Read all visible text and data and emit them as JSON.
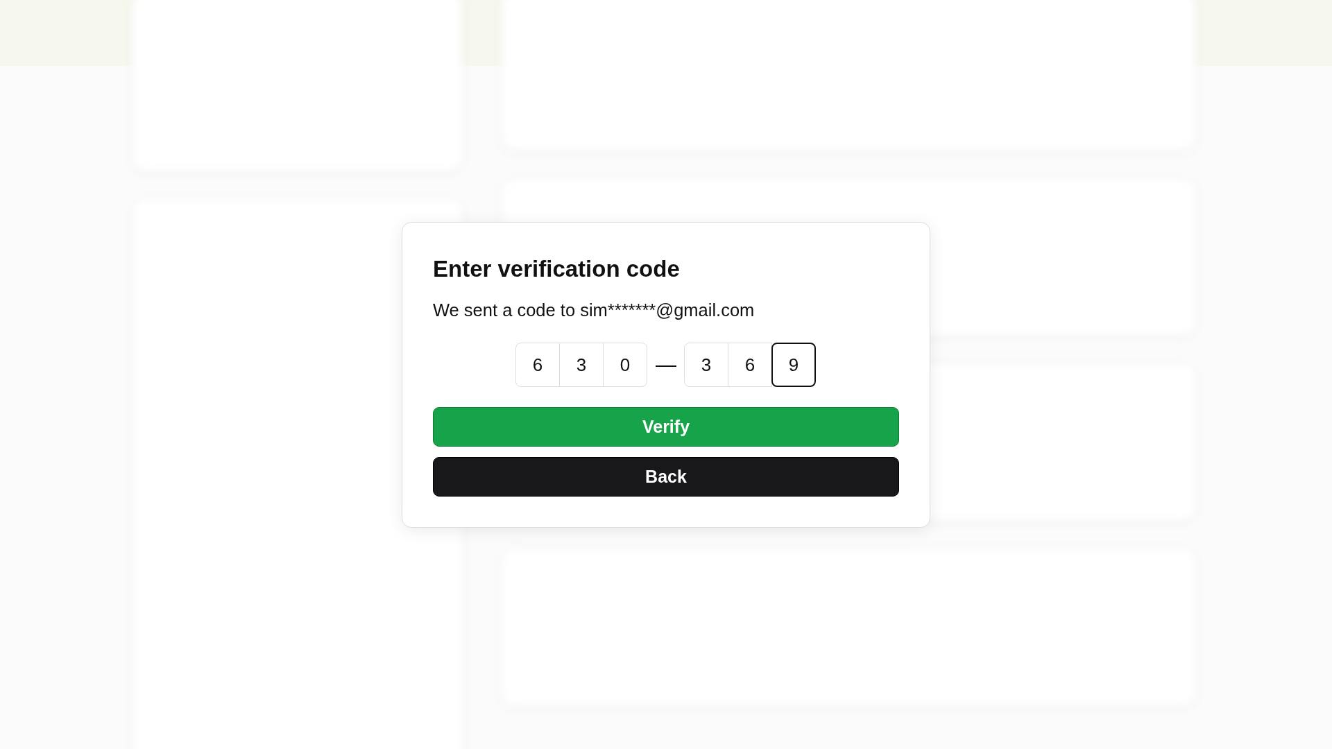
{
  "dialog": {
    "title": "Enter verification code",
    "message": "We sent a code to sim*******@gmail.com",
    "code": {
      "separator": "—",
      "groups": [
        [
          {
            "digit": "6",
            "selected": false
          },
          {
            "digit": "3",
            "selected": false
          },
          {
            "digit": "0",
            "selected": false
          }
        ],
        [
          {
            "digit": "3",
            "selected": false
          },
          {
            "digit": "6",
            "selected": false
          },
          {
            "digit": "9",
            "selected": true
          }
        ]
      ]
    },
    "buttons": [
      {
        "label": "Verify",
        "kind": "primary"
      },
      {
        "label": "Back",
        "kind": "secondary"
      }
    ]
  }
}
